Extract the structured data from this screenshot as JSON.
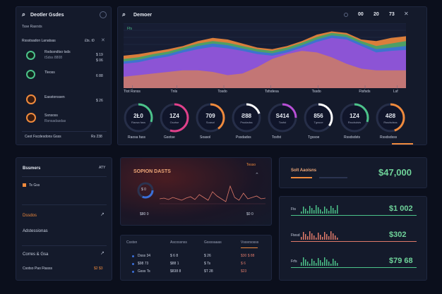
{
  "left_panel": {
    "title": "Deotler Gsdes",
    "subtitle": "Tsse Rasrsts",
    "header_label": "Rssstsadon Lanatsas",
    "header_value": "£ts. t0",
    "items": [
      {
        "line1": "Rsdssndtso tsds",
        "line2": "tSdss 8808",
        "value1": "$ 19",
        "value2": "$ 06",
        "color": "#4cc38a"
      },
      {
        "line1": "Tleoss",
        "line2": "",
        "value1": "",
        "value2": "6 88",
        "color": "#4cc38a"
      },
      {
        "line1": "Easstonssen",
        "line2": "",
        "value1": "$ 26",
        "value2": "",
        "color": "#f08a3c"
      },
      {
        "line1": "Ssnsoss",
        "line2": "Rsnsadasdas",
        "value1": "",
        "value2": "",
        "color": "#f08a3c"
      }
    ],
    "footer_label": "Ceot Fscdesdons Gsss",
    "footer_value": "Rs 238"
  },
  "top_panel": {
    "title": "Demoer",
    "values": [
      "00",
      "20",
      "73"
    ],
    "chart_tag": "Ffs",
    "x_labels": [
      "Ttot Rsnss",
      "Tnls",
      "Tosdo",
      "Tsfsdesa",
      "Tssdo",
      "Ftsfsds",
      "Lsf"
    ],
    "chart_data": {
      "type": "area",
      "series": [
        {
          "values": [
            40,
            42,
            45,
            48,
            52,
            58,
            62,
            60,
            55,
            50,
            48,
            52,
            58,
            66,
            70,
            68,
            60,
            58,
            62,
            64
          ],
          "color": "#f08a3c"
        },
        {
          "values": [
            36,
            38,
            42,
            45,
            50,
            55,
            58,
            56,
            52,
            48,
            46,
            50,
            56,
            63,
            68,
            66,
            58,
            52,
            55,
            58
          ],
          "color": "#3ea36a"
        },
        {
          "values": [
            33,
            35,
            39,
            42,
            47,
            52,
            55,
            53,
            49,
            45,
            43,
            47,
            53,
            60,
            65,
            63,
            55,
            48,
            50,
            52
          ],
          "color": "#3b6fd8"
        },
        {
          "values": [
            30,
            32,
            36,
            39,
            44,
            48,
            51,
            49,
            46,
            42,
            40,
            44,
            50,
            57,
            62,
            60,
            52,
            44,
            46,
            47
          ],
          "color": "#9a4fd6"
        },
        {
          "values": [
            14,
            16,
            18,
            20,
            22,
            22,
            20,
            16,
            18,
            26,
            36,
            42,
            46,
            44,
            38,
            30,
            24,
            22,
            22,
            22
          ],
          "color": "#c97a6a"
        }
      ]
    }
  },
  "gauges": [
    {
      "value": "2Ł0",
      "label": "Raosa fass",
      "fraction": 0.3,
      "color": "#4cc38a"
    },
    {
      "value": "1Z4",
      "label": "Gsotse",
      "fraction": 0.55,
      "color": "#e0408a"
    },
    {
      "value": "709",
      "label": "Soasol",
      "fraction": 0.4,
      "color": "#f08a3c"
    },
    {
      "value": "Ƨ88",
      "label": "Pssdadss",
      "fraction": 0.2,
      "color": "#ffffff"
    },
    {
      "value": "S414",
      "label": "Tosfst",
      "fraction": 0.25,
      "color": "#b84fd6"
    },
    {
      "value": "856",
      "label": "Tgssoe",
      "fraction": 0.35,
      "color": "#ffffff"
    },
    {
      "value": "1Z4",
      "label": "Rssdsdsts",
      "fraction": 0.3,
      "color": "#4cc38a"
    },
    {
      "value": "4Ƨ8",
      "label": "Rssdsdsss",
      "fraction": 0.45,
      "color": "#f08a3c"
    }
  ],
  "bottom_left": {
    "title": "Bssmers",
    "title_value": "ATY",
    "item1": "Ts Gss",
    "item2": "Dssdos",
    "item3": "Adstessionas",
    "item4": "Corres & Gsa",
    "item5": "Csotso Pao Ftasss",
    "item5_value": "$2 $3"
  },
  "middle_chart": {
    "title": "SOPION DASTS",
    "tag": "Tesso",
    "gauge_value": "$ 0",
    "gauge_label": "$80 0",
    "x_end_label": "$0 0"
  },
  "table": {
    "headers": [
      "Csstsn",
      "Ascossnss",
      "Gssssaaas",
      "Vsssrsosss"
    ],
    "rows": [
      [
        "Dsss 34",
        "$ 6 8",
        "$ 26",
        "$30 $ 88"
      ],
      [
        "$98 73",
        "$88 1",
        "$ Ts",
        "$ 6"
      ],
      [
        "Gsss Ts",
        "$838 8",
        "$T 28",
        "$23"
      ]
    ]
  },
  "right_top": {
    "label": "Solt Aaoisns",
    "value": "$47,000"
  },
  "right_bottom": {
    "rows": [
      {
        "tag": "Fts",
        "value": "$1 002",
        "color": "#4cc38a"
      },
      {
        "tag": "Ftesd",
        "value": "$302",
        "color": "#e07a6a"
      },
      {
        "tag": "Frfs",
        "value": "$79 68",
        "color": "#4cc38a"
      }
    ]
  },
  "colors": {
    "accent": "#f08a3c",
    "background": "#0b0f1c",
    "panel": "#141a2b"
  }
}
